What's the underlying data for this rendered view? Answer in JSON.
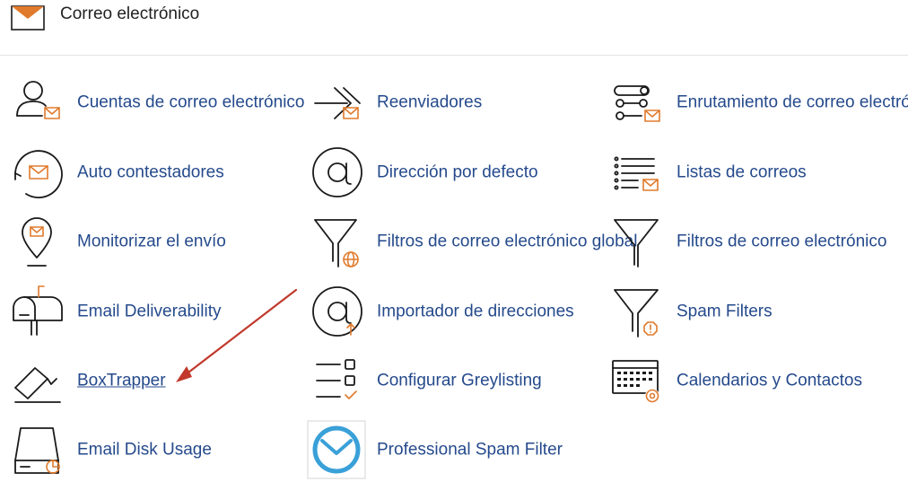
{
  "header": {
    "title": "Correo electrónico",
    "icon": "envelope-icon"
  },
  "items": [
    {
      "label": "Cuentas de correo electrónico",
      "icon": "email-accounts-icon"
    },
    {
      "label": "Reenviadores",
      "icon": "forwarders-icon"
    },
    {
      "label": "Enrutamiento de correo electrónico",
      "icon": "email-routing-icon"
    },
    {
      "label": "Auto contestadores",
      "icon": "autoresponders-icon"
    },
    {
      "label": "Dirección por defecto",
      "icon": "default-address-icon"
    },
    {
      "label": "Listas de correos",
      "icon": "mailing-lists-icon"
    },
    {
      "label": "Monitorizar el envío",
      "icon": "track-delivery-icon"
    },
    {
      "label": "Filtros de correo electrónico global",
      "icon": "global-email-filters-icon"
    },
    {
      "label": "Filtros de correo electrónico",
      "icon": "email-filters-icon"
    },
    {
      "label": "Email Deliverability",
      "icon": "email-deliverability-icon"
    },
    {
      "label": "Importador de direcciones",
      "icon": "address-importer-icon"
    },
    {
      "label": "Spam Filters",
      "icon": "spam-filters-icon"
    },
    {
      "label": "BoxTrapper",
      "icon": "boxtrapper-icon"
    },
    {
      "label": "Configurar Greylisting",
      "icon": "greylisting-icon"
    },
    {
      "label": "Calendarios y Contactos",
      "icon": "calendars-contacts-icon"
    },
    {
      "label": "Email Disk Usage",
      "icon": "email-disk-usage-icon"
    },
    {
      "label": "Professional Spam Filter",
      "icon": "professional-spam-filter-icon"
    }
  ],
  "colors": {
    "link": "#254a8c",
    "accent": "#e07a2c",
    "arrow": "#c0392b",
    "spam_filter_logo": "#3aa0d8"
  }
}
